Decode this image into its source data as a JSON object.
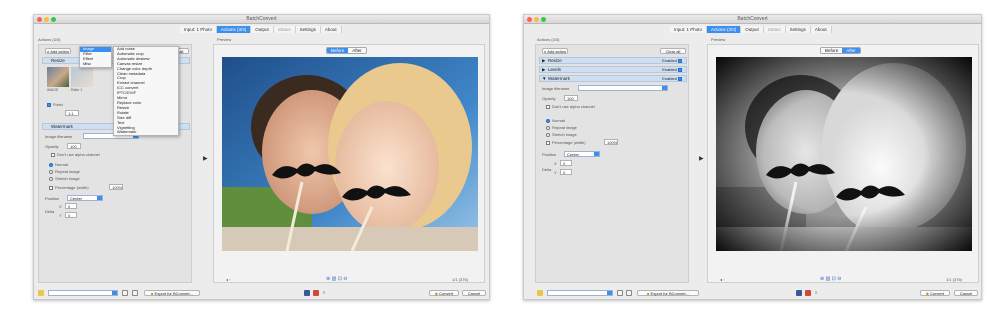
{
  "app": {
    "title": "BatchConvert",
    "tabs": [
      {
        "label": "Input: 1 Photo"
      },
      {
        "label": "Actions (3/3)"
      },
      {
        "label": "Output"
      },
      {
        "label": "Status"
      },
      {
        "label": "Settings"
      },
      {
        "label": "About"
      }
    ],
    "actions_list_label": "Actions (3/3)",
    "preview_label": "Preview",
    "add_action_label": "Add action",
    "view_all_label": "Clear all"
  },
  "left_window": {
    "action_menu": {
      "items": [
        "Image",
        "Filter",
        "Effect",
        "Misc"
      ],
      "selected": "Image"
    },
    "submenu": {
      "items": [
        "Add noise",
        "Automatic crop",
        "Automatic deskew",
        "Canvas resize",
        "Change color depth",
        "Clean metadata",
        "Crop",
        "Extract channel",
        "ICC convert",
        "IPTC/EXIF",
        "Mirror",
        "Replace color",
        "Resize",
        "Rotate",
        "Size diff",
        "Text",
        "Vignetting",
        "Watermark"
      ]
    },
    "first_section": "Resize",
    "thumbnail_caption_1": "IMAGE",
    "thumbnail_caption_2": "Ratio 1",
    "crop_label": "Fixed",
    "crop_value": "1:1",
    "watermark_section": "Watermark",
    "image_label": "Image filename",
    "opacity_label": "Opacity",
    "opacity_value": "100",
    "use_alpha_label": "Don't use alpha channel",
    "mode_options": [
      "Normal",
      "Repeat image",
      "Stretch image"
    ],
    "percentage_label": "Percentage (width)",
    "percentage_value": "100%",
    "position_label": "Position",
    "position_value": "Center",
    "delta_label": "Delta",
    "x_label": "X",
    "y_label": "Y",
    "x_value": "0",
    "y_value": "0",
    "before_after": [
      "Before",
      "After"
    ],
    "active_view": "Before",
    "page_info": "1/1 (376)",
    "export_label": "Export for BConvert...",
    "convert_label": "Convert",
    "cancel_label": "Cancel"
  },
  "right_window": {
    "sections": [
      {
        "label": "Resize",
        "state": "Enabled"
      },
      {
        "label": "Levels",
        "state": "Enabled"
      },
      {
        "label": "Watermark",
        "state": "Enabled"
      }
    ],
    "image_label": "Image filename",
    "opacity_label": "Opacity",
    "opacity_value": "100",
    "use_alpha_label": "Don't use alpha channel",
    "mode_options": [
      "Normal",
      "Repeat image",
      "Stretch image"
    ],
    "percentage_label": "Percentage (width)",
    "percentage_value": "100%",
    "position_label": "Position",
    "position_value": "Center",
    "delta_label": "Delta",
    "x_label": "X",
    "y_label": "Y",
    "x_value": "0",
    "y_value": "0",
    "before_after": [
      "Before",
      "After"
    ],
    "active_view": "After",
    "page_info": "1/1 (376)",
    "export_label": "Export for BConvert...",
    "convert_label": "Convert",
    "cancel_label": "Cancel"
  },
  "colors": {
    "accent": "#3b8ff0",
    "window_bg": "#ececec",
    "section_bg": "#cfdff2"
  }
}
